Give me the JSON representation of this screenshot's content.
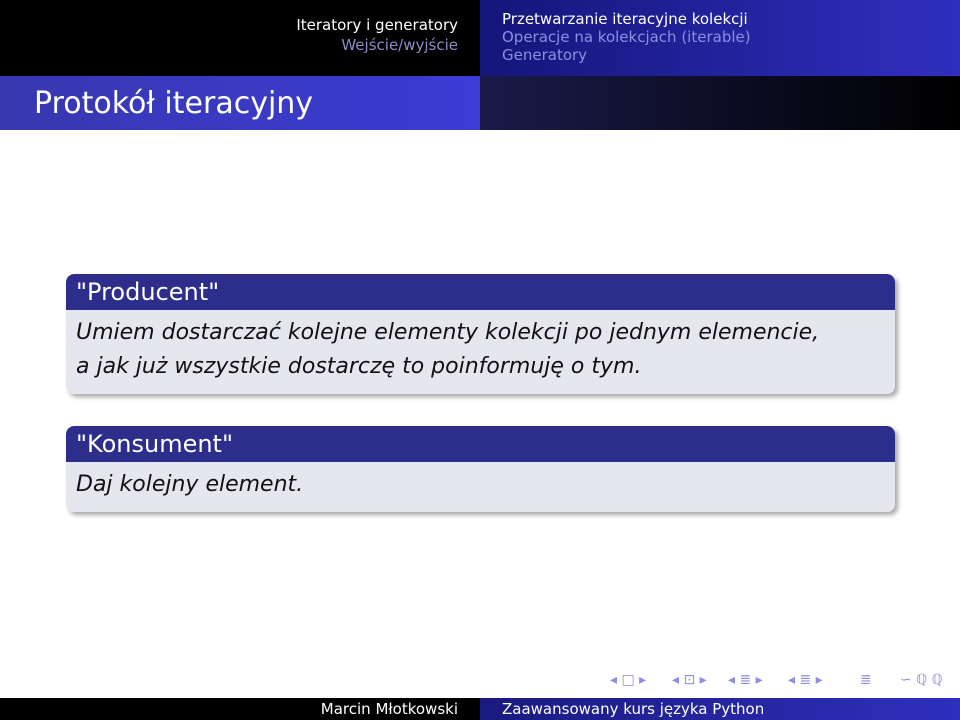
{
  "header": {
    "section_title": "Iteratory i generatory",
    "section_sub": "Wejście/wyjście",
    "subsections": [
      "Przetwarzanie iteracyjne kolekcji",
      "Operacje na kolekcjach (iterable)",
      "Generatory"
    ],
    "active_subsection": 0
  },
  "frame": {
    "title": "Protokół iteracyjny"
  },
  "blocks": [
    {
      "title": "\"Producent\"",
      "lines": [
        "Umiem dostarczać kolejne elementy kolekcji po jednym elemencie,",
        "a jak już wszystkie dostarczę to poinformuję o tym."
      ]
    },
    {
      "title": "\"Konsument\"",
      "lines": [
        "Daj kolejny element."
      ]
    }
  ],
  "footer": {
    "author": "Marcin Młotkowski",
    "title": "Zaawansowany kurs języka Python"
  },
  "nav_symbols": {
    "frame": "◂ □ ▸",
    "subsection": "◂ ⊡ ▸",
    "section": "◂ ≣ ▸",
    "subsection2": "◂ ≣ ▸",
    "align": "≣",
    "search": "∽ ℚ ℚ"
  },
  "colors": {
    "bar_dark": "#000000",
    "bar_blue": "#2f2fbf",
    "block_title_bg": "#2d2d8c",
    "block_body_bg": "#e6e6ef",
    "inactive_nav": "#8e8ee0"
  }
}
